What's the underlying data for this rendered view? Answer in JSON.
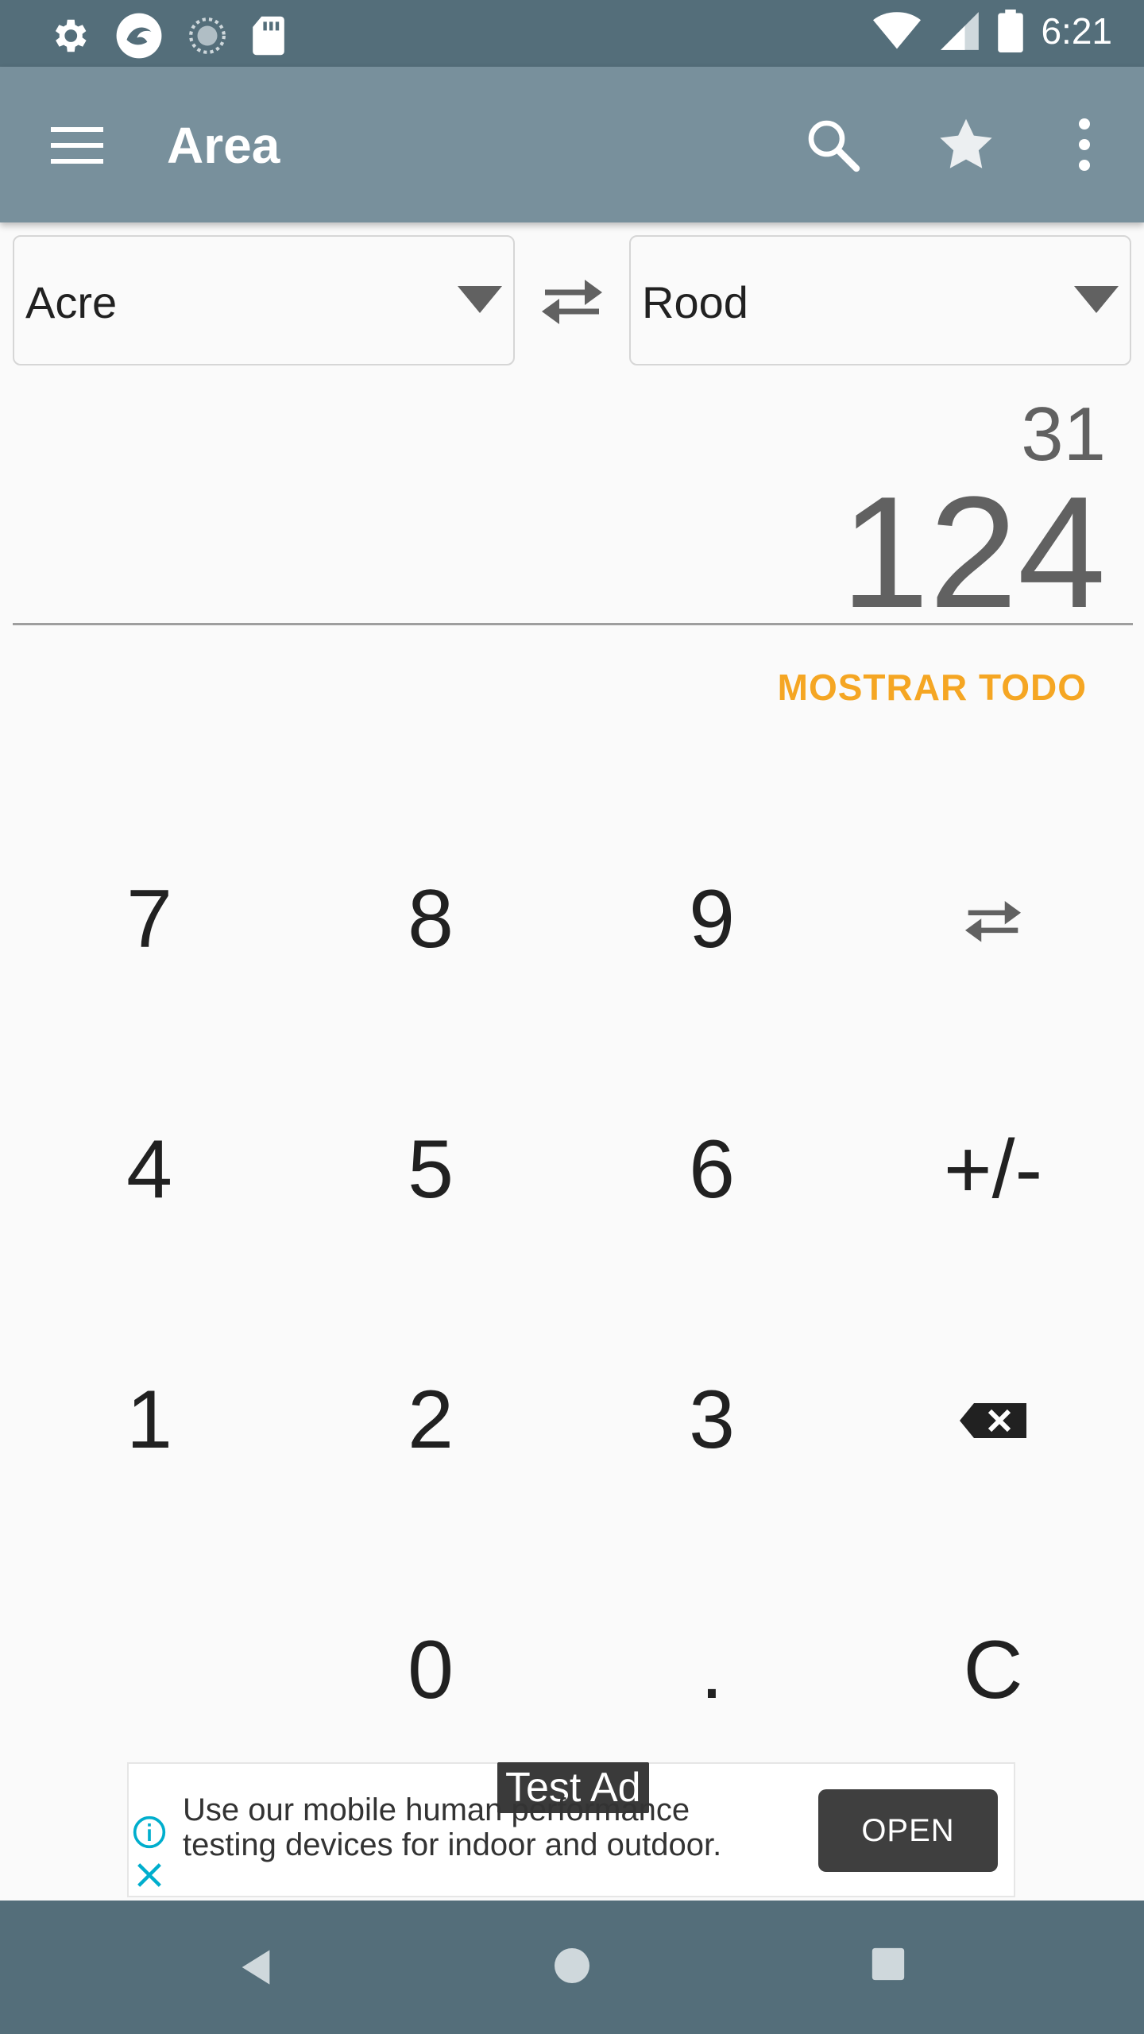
{
  "status_bar": {
    "time": "6:21",
    "left_icons": [
      "settings-icon",
      "app-icon",
      "loading-icon",
      "sd-card-icon"
    ],
    "right_icons": [
      "wifi-icon",
      "signal-icon",
      "battery-icon"
    ]
  },
  "app_bar": {
    "title": "Area",
    "icons": [
      "menu-icon",
      "search-icon",
      "star-icon",
      "more-vert-icon"
    ]
  },
  "converter": {
    "from_unit": "Acre",
    "to_unit": "Rood",
    "input_value": "31",
    "result_value": "124",
    "show_all_label": "MOSTRAR TODO"
  },
  "keypad": {
    "keys": [
      "7",
      "8",
      "9",
      "swap-icon",
      "4",
      "5",
      "6",
      "+/-",
      "1",
      "2",
      "3",
      "backspace-icon",
      "",
      "0",
      ".",
      "C"
    ]
  },
  "ad": {
    "tag": "Test Ad",
    "text_line1": "Use our mobile human performance",
    "text_line2": "testing devices for indoor and outdoor.",
    "open_label": "OPEN"
  },
  "colors": {
    "status_bar": "#546e7a",
    "app_bar": "#78909c",
    "accent": "#f5a623",
    "text": "#212121",
    "display_text": "#616161"
  }
}
